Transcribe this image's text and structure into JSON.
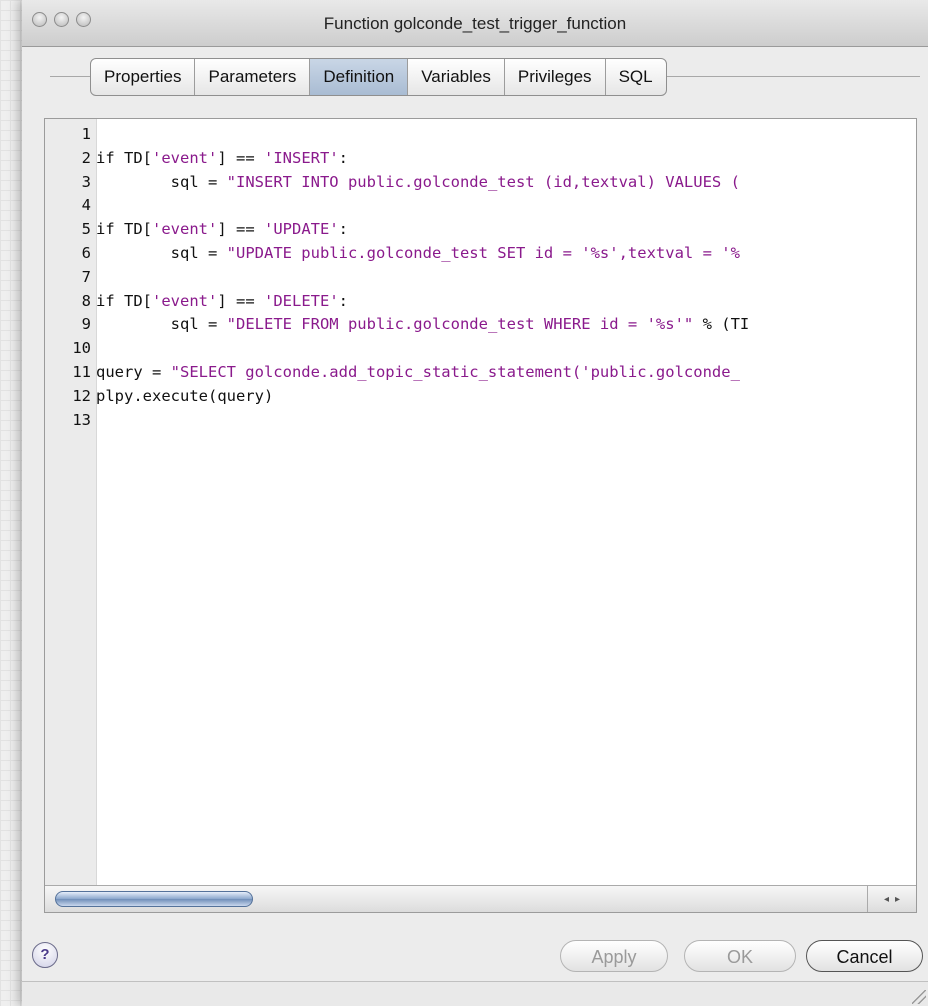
{
  "window": {
    "title": "Function golconde_test_trigger_function"
  },
  "tabs": [
    {
      "label": "Properties",
      "active": false
    },
    {
      "label": "Parameters",
      "active": false
    },
    {
      "label": "Definition",
      "active": true
    },
    {
      "label": "Variables",
      "active": false
    },
    {
      "label": "Privileges",
      "active": false
    },
    {
      "label": "SQL",
      "active": false
    }
  ],
  "editor": {
    "lines": [
      {
        "num": "1",
        "segments": []
      },
      {
        "num": "2",
        "segments": [
          {
            "t": "if TD[",
            "c": "src"
          },
          {
            "t": "'event'",
            "c": "str"
          },
          {
            "t": "] == ",
            "c": "src"
          },
          {
            "t": "'INSERT'",
            "c": "str"
          },
          {
            "t": ":",
            "c": "src"
          }
        ]
      },
      {
        "num": "3",
        "segments": [
          {
            "t": "        sql = ",
            "c": "src"
          },
          {
            "t": "\"INSERT INTO public.golconde_test (id,textval) VALUES (",
            "c": "str"
          }
        ]
      },
      {
        "num": "4",
        "segments": []
      },
      {
        "num": "5",
        "segments": [
          {
            "t": "if TD[",
            "c": "src"
          },
          {
            "t": "'event'",
            "c": "str"
          },
          {
            "t": "] == ",
            "c": "src"
          },
          {
            "t": "'UPDATE'",
            "c": "str"
          },
          {
            "t": ":",
            "c": "src"
          }
        ]
      },
      {
        "num": "6",
        "segments": [
          {
            "t": "        sql = ",
            "c": "src"
          },
          {
            "t": "\"UPDATE public.golconde_test SET id = '%s',textval = '%",
            "c": "str"
          }
        ]
      },
      {
        "num": "7",
        "segments": []
      },
      {
        "num": "8",
        "segments": [
          {
            "t": "if TD[",
            "c": "src"
          },
          {
            "t": "'event'",
            "c": "str"
          },
          {
            "t": "] == ",
            "c": "src"
          },
          {
            "t": "'DELETE'",
            "c": "str"
          },
          {
            "t": ":",
            "c": "src"
          }
        ]
      },
      {
        "num": "9",
        "segments": [
          {
            "t": "        sql = ",
            "c": "src"
          },
          {
            "t": "\"DELETE FROM public.golconde_test WHERE id = '%s'\"",
            "c": "str"
          },
          {
            "t": " % (TI",
            "c": "src"
          }
        ]
      },
      {
        "num": "10",
        "segments": []
      },
      {
        "num": "11",
        "segments": [
          {
            "t": "query = ",
            "c": "src"
          },
          {
            "t": "\"SELECT golconde.add_topic_static_statement('public.golconde_",
            "c": "str"
          }
        ]
      },
      {
        "num": "12",
        "segments": [
          {
            "t": "plpy.execute(query)",
            "c": "src"
          }
        ]
      },
      {
        "num": "13",
        "segments": []
      }
    ]
  },
  "buttons": {
    "help": "?",
    "apply": "Apply",
    "ok": "OK",
    "cancel": "Cancel"
  },
  "scroll_arrows": {
    "left": "◂",
    "right": "▸"
  }
}
